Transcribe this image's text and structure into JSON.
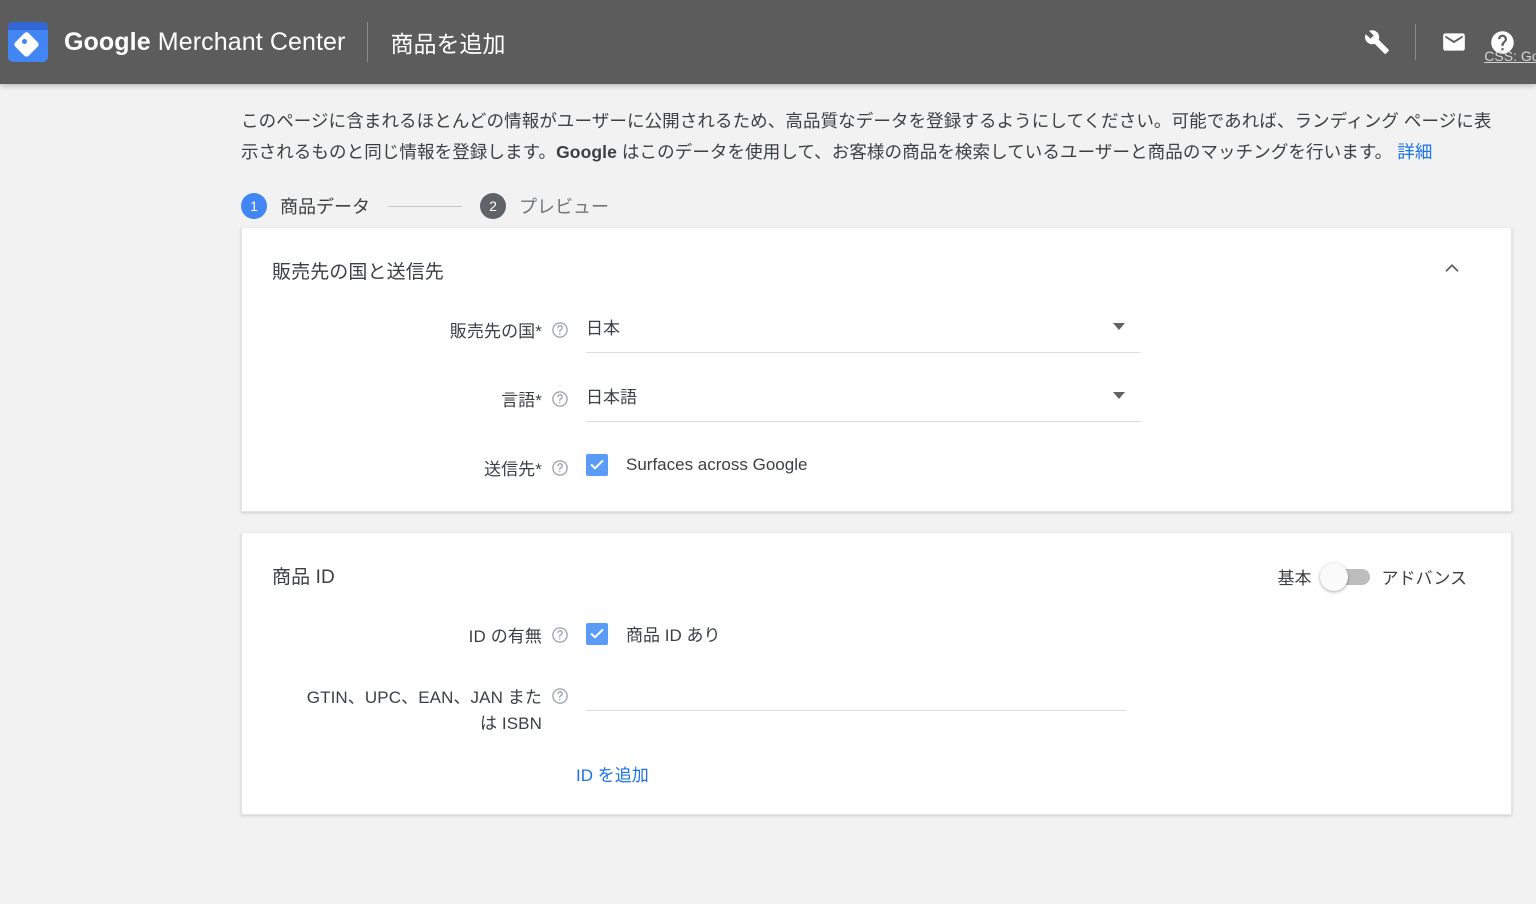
{
  "header": {
    "brand_bold": "Google",
    "brand_light": " Merchant Center",
    "page_title": "商品を追加",
    "icons": {
      "tools": "wrench-icon",
      "mail": "mail-icon",
      "help": "help-icon"
    },
    "css_label": "CSS: Google"
  },
  "intro": {
    "part1": "このページに含まれるほとんどの情報がユーザーに公開されるため、高品質なデータを登録するようにしてください。可能であれば、ランディング ページに表示されるものと同じ情報を登録します。",
    "brand": "Google",
    "part2": " はこのデータを使用して、お客様の商品を検索しているユーザーと商品のマッチングを行います。 ",
    "link": "詳細"
  },
  "stepper": {
    "steps": [
      {
        "num": "1",
        "label": "商品データ",
        "state": "active"
      },
      {
        "num": "2",
        "label": "プレビュー",
        "state": "inactive"
      }
    ]
  },
  "cards": [
    {
      "title": "販売先の国と送信先",
      "collapse_icon": "chevron-up-icon",
      "fields": {
        "country": {
          "label": "販売先の国*",
          "value": "日本",
          "help": "help-icon"
        },
        "language": {
          "label": "言語*",
          "value": "日本語",
          "help": "help-icon"
        },
        "destination": {
          "label": "送信先*",
          "checkbox_label": "Surfaces across Google",
          "checked": true,
          "help": "help-icon"
        }
      }
    },
    {
      "title": "商品 ID",
      "toggle": {
        "left_label": "基本",
        "right_label": "アドバンス",
        "state": "off"
      },
      "fields": {
        "has_id": {
          "label": "ID の有無",
          "checkbox_label": "商品 ID あり",
          "checked": true,
          "help": "help-icon"
        },
        "gtin": {
          "label_line1": "GTIN、UPC、EAN、JAN また",
          "label_line2": "は ISBN",
          "value": "",
          "placeholder": "",
          "help": "help-icon"
        },
        "add_id_link": "ID を追加"
      }
    }
  ],
  "colors": {
    "header_bg": "#5c5c5c",
    "page_bg": "#f2f2f2",
    "accent_blue": "#4285f4",
    "link_blue": "#1a73e8",
    "checkbox_blue": "#5b9bf8",
    "step_inactive": "#5f6368"
  }
}
